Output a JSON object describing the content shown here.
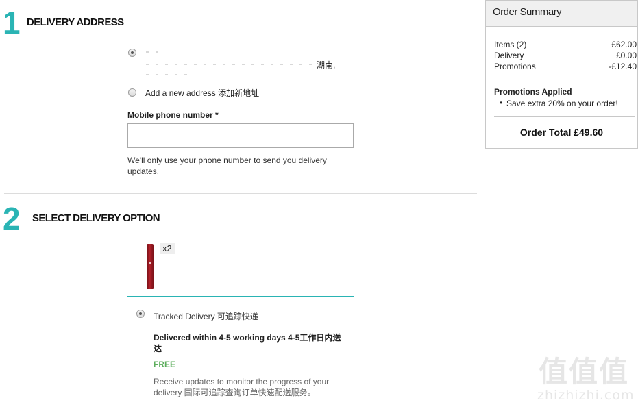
{
  "step1": {
    "number": "1",
    "title": "DELIVERY ADDRESS"
  },
  "address": {
    "fragment": "湖南,",
    "add_new_label": "Add a new address 添加新地址"
  },
  "phone": {
    "label": "Mobile phone number *",
    "value": "",
    "help": "We'll only use your phone number to send you delivery updates."
  },
  "step2": {
    "number": "2",
    "title": "SELECT DELIVERY OPTION"
  },
  "product": {
    "quantity": "x2"
  },
  "delivery_option": {
    "name": "Tracked Delivery 可追踪快递",
    "timing": "Delivered within 4-5 working days 4-5工作日内送达",
    "price": "FREE",
    "description": "Receive updates to monitor the progress of your delivery 国际可追踪查询订单快速配送服务。"
  },
  "summary": {
    "title": "Order Summary",
    "rows": [
      {
        "label": "Items (2)",
        "value": "£62.00"
      },
      {
        "label": "Delivery",
        "value": "£0.00"
      },
      {
        "label": "Promotions",
        "value": "-£12.40"
      }
    ],
    "promotions_heading": "Promotions Applied",
    "promotions": [
      "Save extra 20% on your order!"
    ],
    "total_label": "Order Total £49.60"
  },
  "watermark": {
    "logo": "值值值",
    "site": "zhizhizhi.com"
  },
  "colors": {
    "accent": "#2ab4b4",
    "free": "#5cad5c"
  }
}
